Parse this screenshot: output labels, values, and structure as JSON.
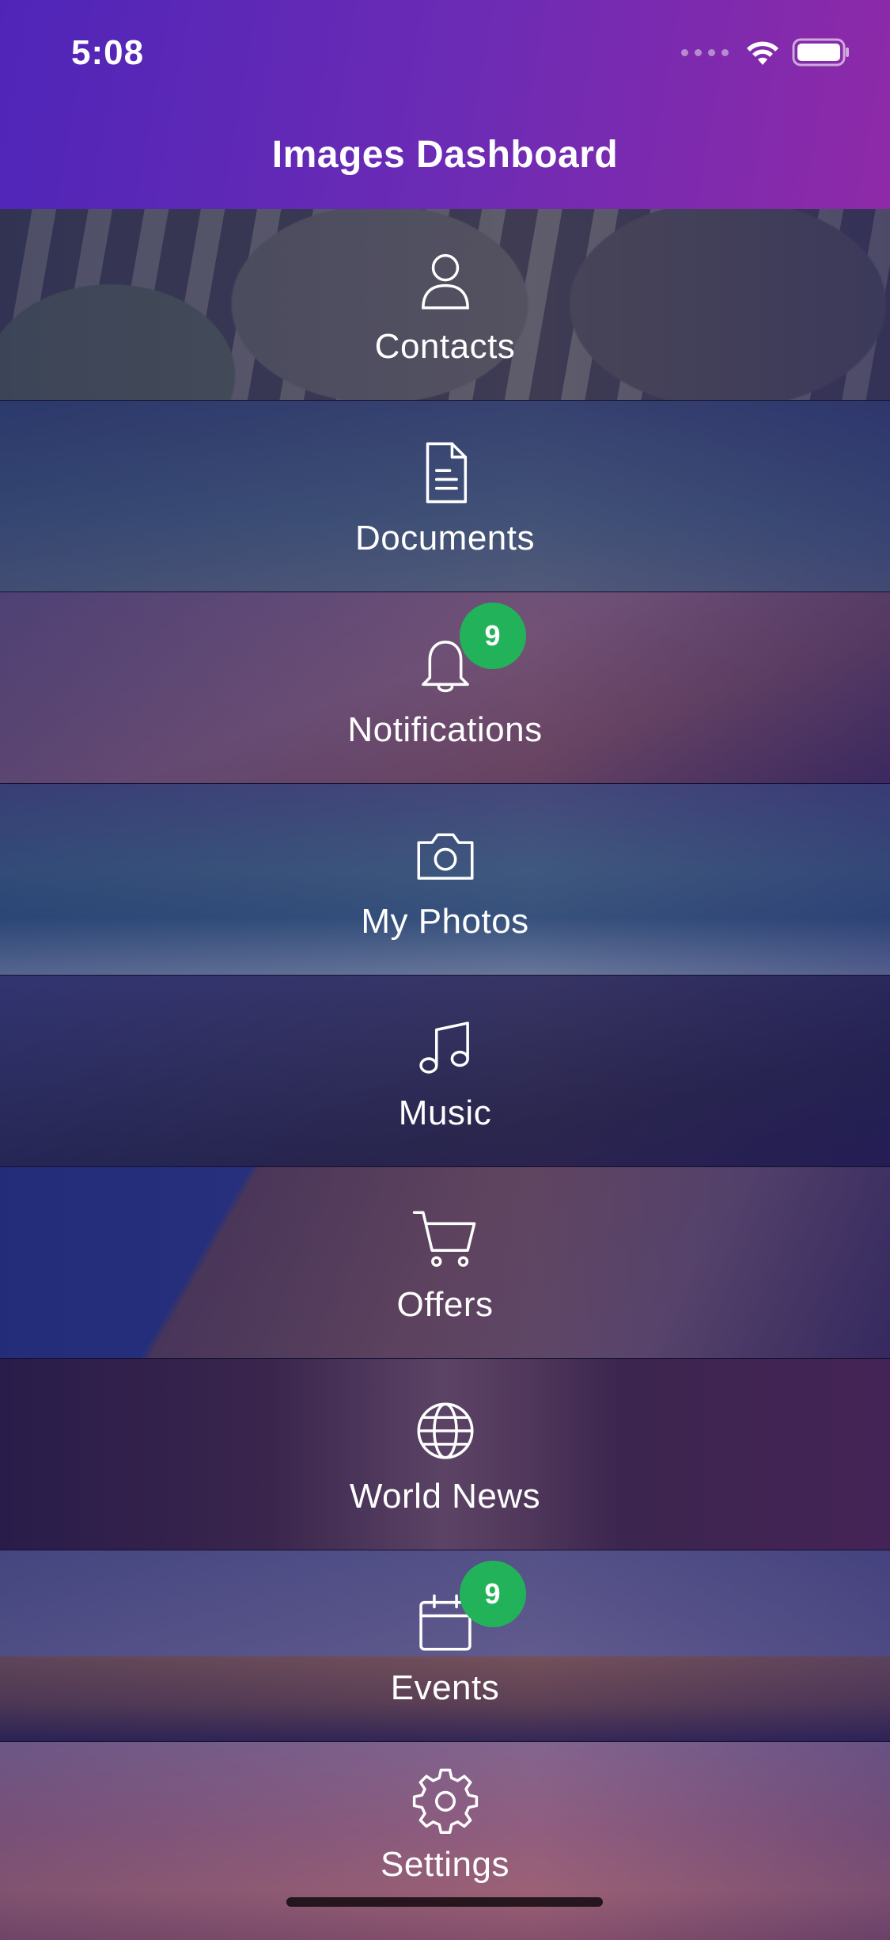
{
  "status_bar": {
    "time": "5:08"
  },
  "header": {
    "title": "Images Dashboard"
  },
  "menu": [
    {
      "label": "Contacts",
      "icon": "person-icon"
    },
    {
      "label": "Documents",
      "icon": "document-icon"
    },
    {
      "label": "Notifications",
      "icon": "bell-icon",
      "badge": "9"
    },
    {
      "label": "My Photos",
      "icon": "camera-icon"
    },
    {
      "label": "Music",
      "icon": "music-note-icon"
    },
    {
      "label": "Offers",
      "icon": "cart-icon"
    },
    {
      "label": "World News",
      "icon": "globe-icon"
    },
    {
      "label": "Events",
      "icon": "calendar-icon",
      "badge": "9"
    },
    {
      "label": "Settings",
      "icon": "gear-icon"
    }
  ],
  "colors": {
    "header_start": "#4f25b8",
    "header_end": "#8e2aa8",
    "badge": "#22b35a"
  }
}
